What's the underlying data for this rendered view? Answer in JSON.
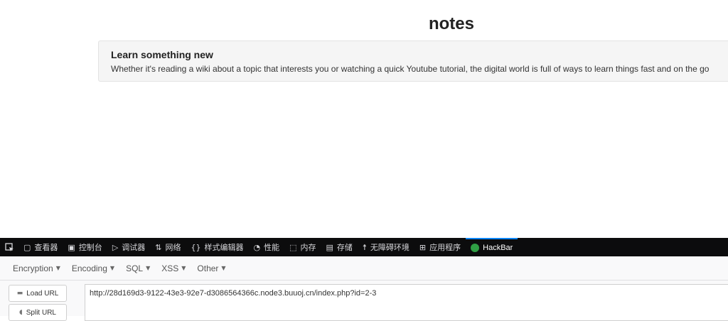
{
  "page": {
    "title": "notes",
    "note": {
      "heading": "Learn something new",
      "body": "Whether it's reading a wiki about a topic that interests you or watching a quick Youtube tutorial, the digital world is full of ways to learn things fast and on the go"
    }
  },
  "devtools": {
    "tabs": [
      {
        "label": "查看器",
        "icon": "inspector-icon"
      },
      {
        "label": "控制台",
        "icon": "console-icon"
      },
      {
        "label": "调试器",
        "icon": "debugger-icon"
      },
      {
        "label": "网络",
        "icon": "network-icon"
      },
      {
        "label": "样式编辑器",
        "icon": "style-editor-icon"
      },
      {
        "label": "性能",
        "icon": "performance-icon"
      },
      {
        "label": "内存",
        "icon": "memory-icon"
      },
      {
        "label": "存储",
        "icon": "storage-icon"
      },
      {
        "label": "无障碍环境",
        "icon": "accessibility-icon"
      },
      {
        "label": "应用程序",
        "icon": "application-icon"
      },
      {
        "label": "HackBar",
        "icon": "hackbar-icon"
      }
    ],
    "active_tab": "HackBar"
  },
  "hackbar": {
    "menu": {
      "encryption": "Encryption",
      "encoding": "Encoding",
      "sql": "SQL",
      "xss": "XSS",
      "other": "Other"
    },
    "load_url": "Load URL",
    "split_url": "Split URL",
    "url_value": "http://28d169d3-9122-43e3-92e7-d3086564366c.node3.buuoj.cn/index.php?id=2-3"
  },
  "colors": {
    "devtools_bg": "#0c0c0d",
    "active_tab_accent": "#0a84ff",
    "hackbar_logo": "#2f9e44",
    "card_bg": "#f5f5f5"
  }
}
